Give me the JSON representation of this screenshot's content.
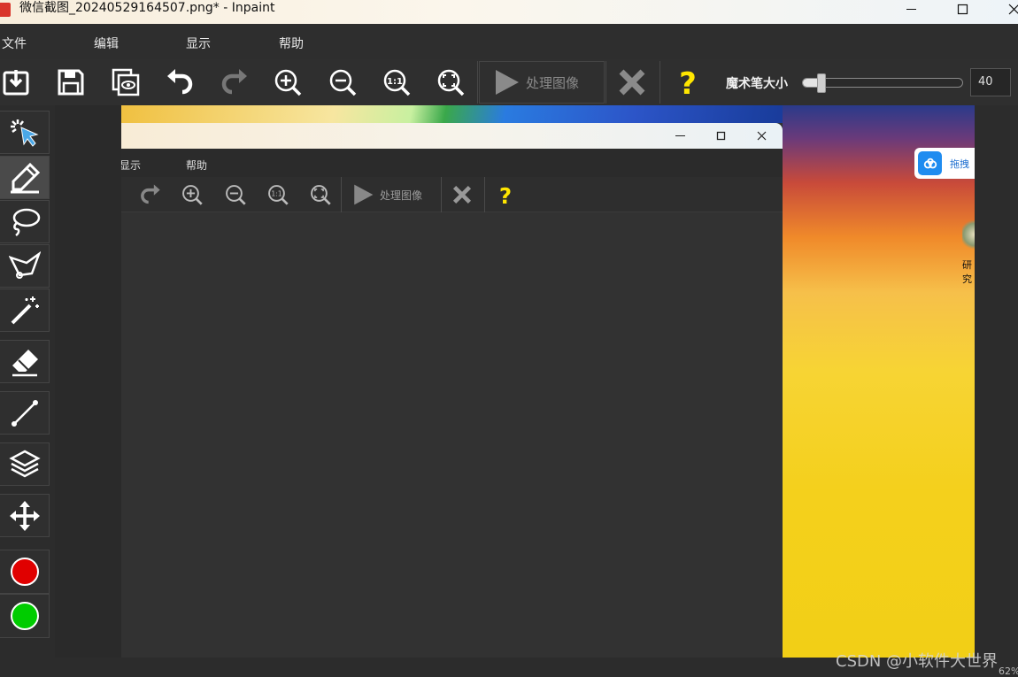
{
  "window": {
    "title": "微信截图_20240529164507.png* - Inpaint"
  },
  "menu": {
    "items": [
      "文件",
      "编辑",
      "显示",
      "帮助"
    ]
  },
  "toolbar": {
    "process_label": "处理图像",
    "magic_wand_label": "魔术笔大小",
    "magic_wand_size": "40",
    "magic_wand_level": 0.1,
    "icons": [
      "open-icon",
      "save-icon",
      "copy-preview-icon",
      "undo-icon",
      "redo-icon",
      "zoom-in-icon",
      "zoom-out-icon",
      "actual-size-icon",
      "fit-screen-icon",
      "play-icon",
      "cancel-icon",
      "help-icon"
    ]
  },
  "left_tools": {
    "icons": [
      "selection-icon",
      "marker-icon",
      "lasso-icon",
      "polygon-lasso-icon",
      "magic-wand-icon",
      "eraser-icon",
      "line-icon",
      "layers-icon",
      "move-icon",
      "red-color-icon",
      "green-color-icon"
    ],
    "colors": {
      "red": "#e00000",
      "green": "#00cc00"
    }
  },
  "canvas": {
    "baidu_label": "拖拽",
    "desktop_label": "研究",
    "inner_menu": [
      "显示",
      "帮助"
    ],
    "inner_process_label": "处理图像"
  },
  "status": {
    "zoom": "62%"
  },
  "watermark": "CSDN @小软件大世界"
}
